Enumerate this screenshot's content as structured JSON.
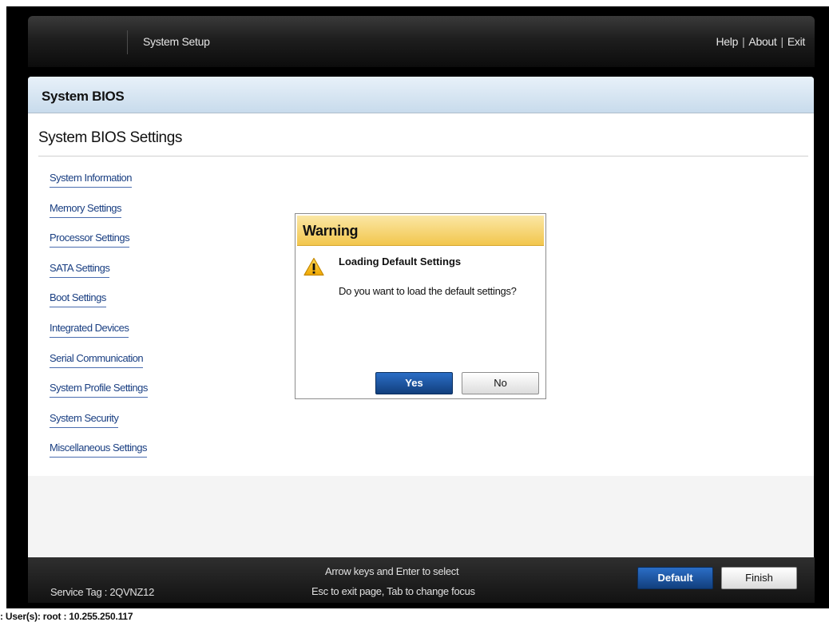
{
  "header": {
    "title": "System Setup",
    "links": [
      "Help",
      "About",
      "Exit"
    ]
  },
  "panel": {
    "title": "System BIOS",
    "heading": "System BIOS Settings",
    "menu": [
      "System Information",
      "Memory Settings",
      "Processor Settings",
      "SATA Settings",
      "Boot Settings",
      "Integrated Devices",
      "Serial Communication",
      "System Profile Settings",
      "System Security",
      "Miscellaneous Settings"
    ]
  },
  "dialog": {
    "title": "Warning",
    "heading": "Loading Default Settings",
    "message": "Do you want to load the default settings?",
    "yes_label": "Yes",
    "no_label": "No"
  },
  "footer": {
    "service_tag": "Service Tag : 2QVNZ12",
    "hint_line1": "Arrow keys and Enter to select",
    "hint_line2": "Esc to exit page, Tab to change focus",
    "default_label": "Default",
    "finish_label": "Finish"
  },
  "status_line": ": User(s): root : 10.255.250.117",
  "colors": {
    "header_bg": "#1e1e1e",
    "panel_title_bg": "#c8dbec",
    "link": "#1a3f82",
    "warning_bar": "#f2c64d",
    "primary_button": "#1a4f98"
  }
}
